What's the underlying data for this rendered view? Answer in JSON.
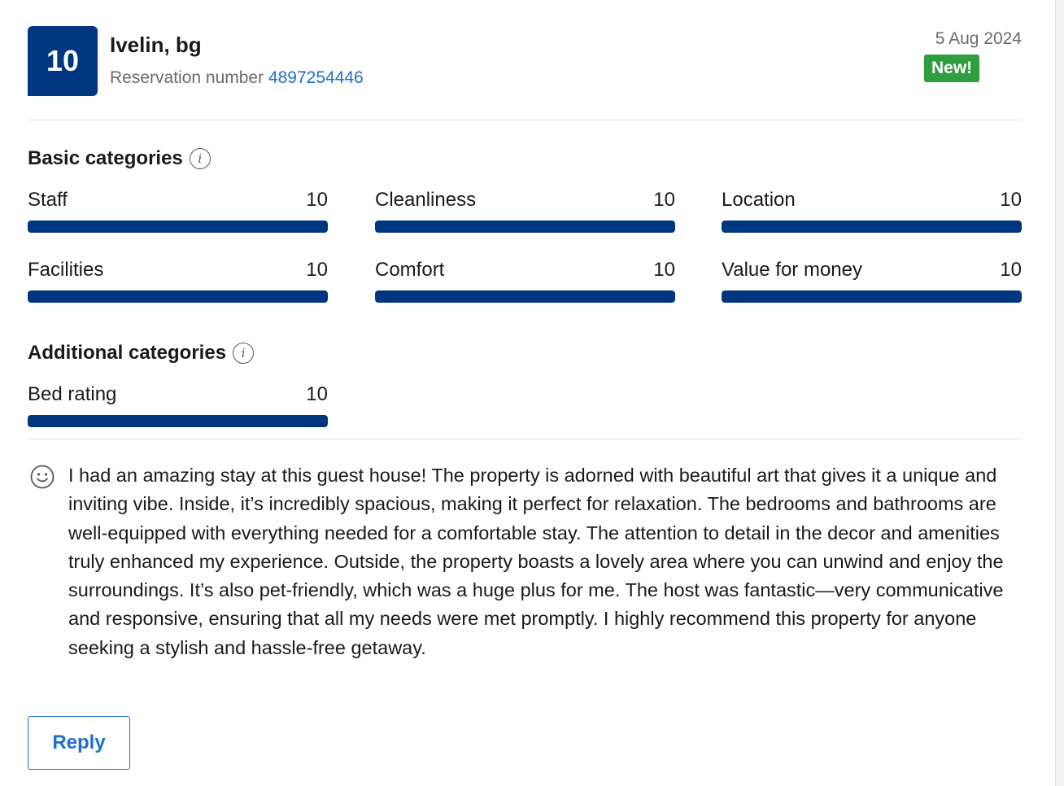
{
  "review": {
    "score": "10",
    "guest_name": "Ivelin, bg",
    "reservation_label": "Reservation number",
    "reservation_number": "4897254446",
    "date": "5 Aug 2024",
    "badge": "New!"
  },
  "basic_categories": {
    "title": "Basic categories",
    "items": [
      {
        "label": "Staff",
        "score": "10",
        "fraction": 1.0
      },
      {
        "label": "Cleanliness",
        "score": "10",
        "fraction": 1.0
      },
      {
        "label": "Location",
        "score": "10",
        "fraction": 1.0
      },
      {
        "label": "Facilities",
        "score": "10",
        "fraction": 1.0
      },
      {
        "label": "Comfort",
        "score": "10",
        "fraction": 1.0
      },
      {
        "label": "Value for money",
        "score": "10",
        "fraction": 1.0
      }
    ]
  },
  "additional_categories": {
    "title": "Additional categories",
    "items": [
      {
        "label": "Bed rating",
        "score": "10",
        "fraction": 1.0
      }
    ]
  },
  "comment": {
    "icon": "smile-icon",
    "text": "I had an amazing stay at this guest house! The property is adorned with beautiful art that gives it a unique and inviting vibe. Inside, it’s incredibly spacious, making it perfect for relaxation. The bedrooms and bathrooms are well-equipped with everything needed for a comfortable stay. The attention to detail in the decor and amenities truly enhanced my experience. Outside, the property boasts a lovely area where you can unwind and enjoy the surroundings. It’s also pet-friendly, which was a huge plus for me. The host was fantastic—very communicative and responsive, ensuring that all my needs were met promptly. I highly recommend this property for anyone seeking a stylish and hassle-free getaway."
  },
  "actions": {
    "reply_label": "Reply"
  },
  "colors": {
    "brand": "#003580",
    "link": "#1e6fd0",
    "badge": "#2e9e3e"
  }
}
